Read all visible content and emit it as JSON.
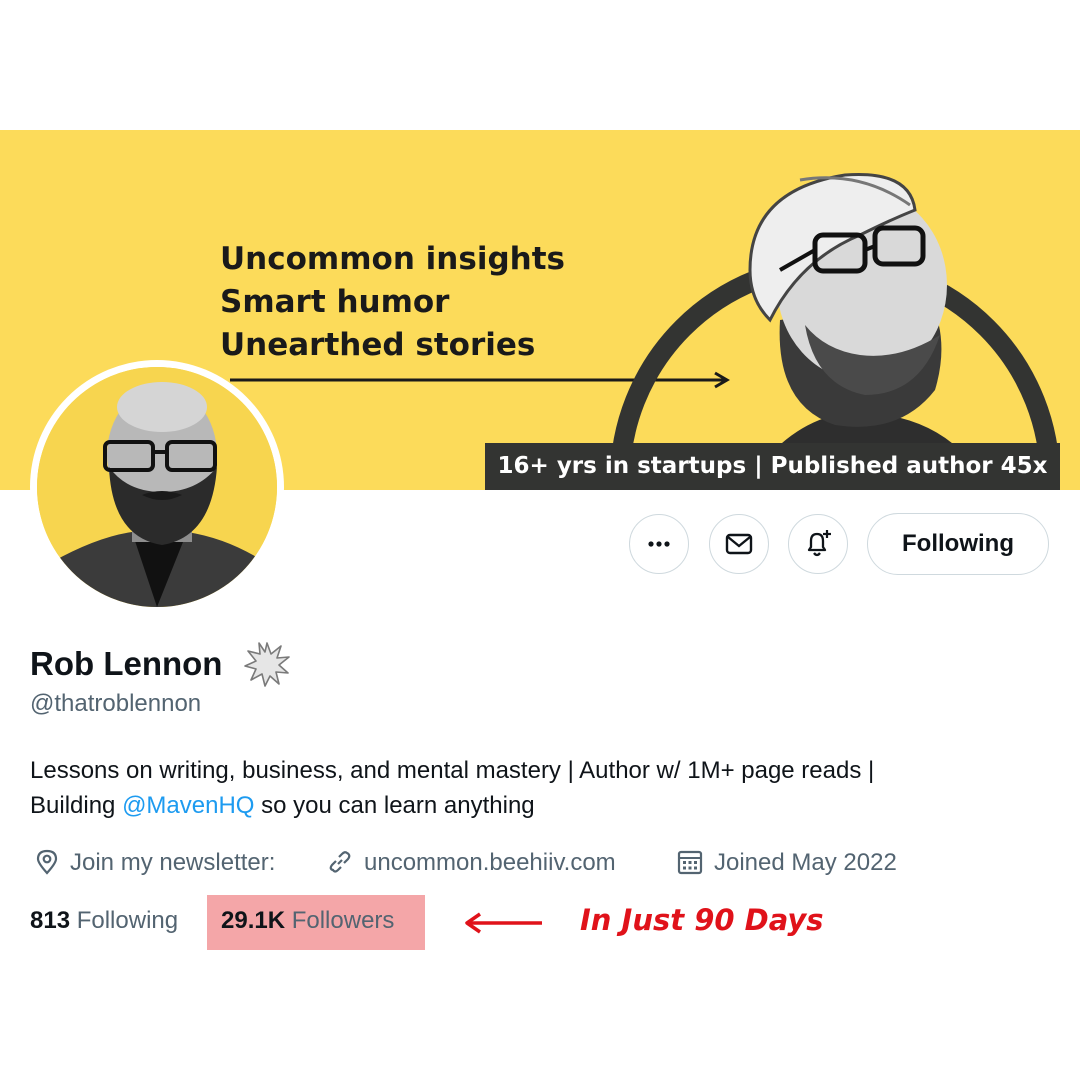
{
  "banner": {
    "tagline_lines": [
      "Uncommon insights",
      "Smart humor",
      "Unearthed stories"
    ],
    "stats_strip": "16+ yrs in startups | Published author 45x",
    "background_color": "#fcdb5a"
  },
  "actions": {
    "more_icon": "more-dots-icon",
    "message_icon": "envelope-icon",
    "notify_icon": "bell-plus-icon",
    "follow_label": "Following"
  },
  "profile": {
    "name": "Rob Lennon",
    "badge_icon": "starburst-badge-icon",
    "handle": "@thatroblennon",
    "bio_line1": "Lessons on writing, business, and mental mastery | Author w/ 1M+ page reads |",
    "bio_line2_prefix": "Building ",
    "bio_line2_mention": "@MavenHQ",
    "bio_line2_suffix": " so you can learn anything",
    "location_label": "Join my newsletter:",
    "website": "uncommon.beehiiv.com",
    "joined": "Joined May 2022"
  },
  "counts": {
    "following_value": "813",
    "following_label": "Following",
    "followers_value": "29.1K",
    "followers_label": "Followers"
  },
  "annotation": {
    "text": "In Just 90 Days",
    "color": "#e0121a",
    "highlight_color": "#f4a6a8"
  }
}
